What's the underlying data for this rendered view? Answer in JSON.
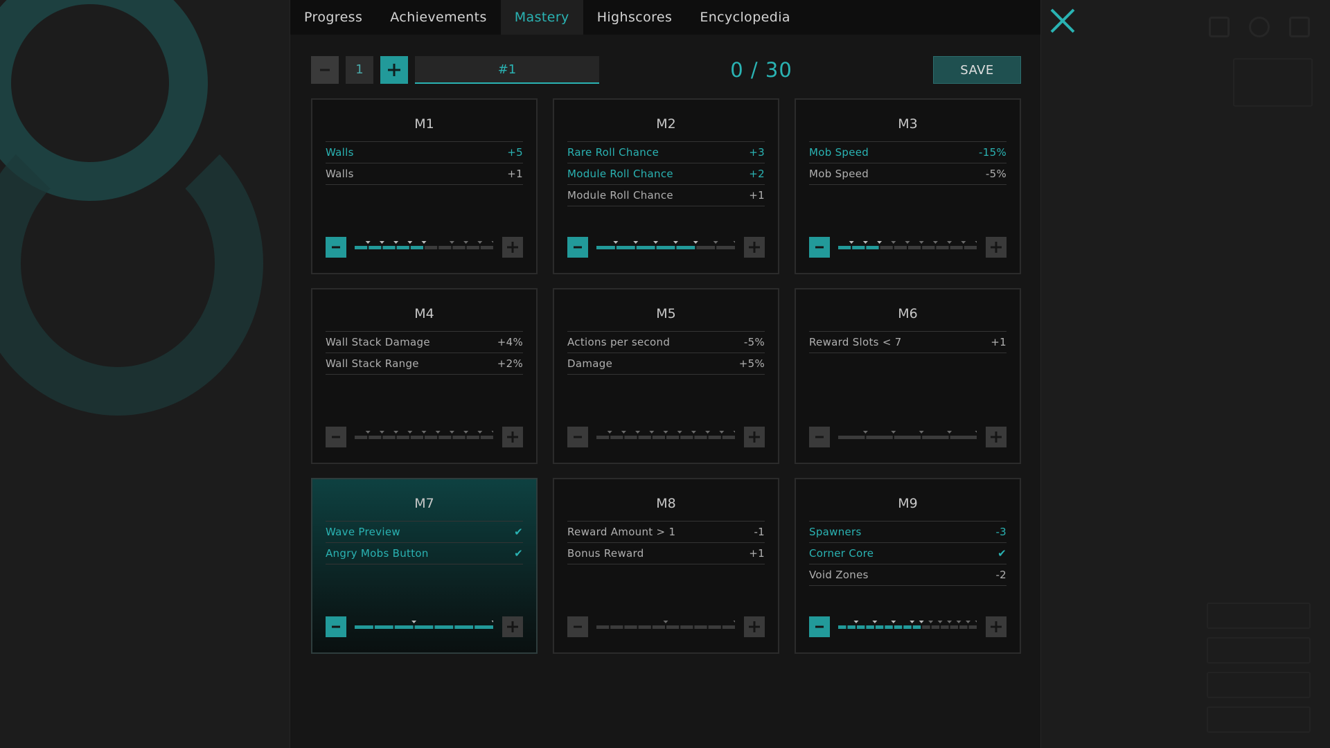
{
  "tabs": [
    "Progress",
    "Achievements",
    "Mastery",
    "Highscores",
    "Encyclopedia"
  ],
  "active_tab": 2,
  "toolbar": {
    "preset_number": "1",
    "preset_name": "#1",
    "points": "0 / 30",
    "save_label": "SAVE"
  },
  "colors": {
    "accent": "#2ab3b3",
    "accent_button": "#229a9a",
    "inactive": "#3a3a3a",
    "text": "#b0b0b0"
  },
  "icons": {
    "close": "close-icon",
    "minus": "minus-icon",
    "plus": "plus-icon",
    "check": "check-icon"
  },
  "cards": [
    {
      "title": "M1",
      "active": true,
      "highlight": false,
      "stats": [
        {
          "label": "Walls",
          "value": "+5",
          "on": true
        },
        {
          "label": "Walls",
          "value": "+1",
          "on": false
        }
      ],
      "level": {
        "segments": 10,
        "filled": 5,
        "markers": [
          1,
          2,
          3,
          4,
          5,
          7,
          8,
          9,
          10
        ]
      }
    },
    {
      "title": "M2",
      "active": true,
      "highlight": false,
      "stats": [
        {
          "label": "Rare Roll Chance",
          "value": "+3",
          "on": true
        },
        {
          "label": "Module Roll Chance",
          "value": "+2",
          "on": true
        },
        {
          "label": "Module Roll Chance",
          "value": "+1",
          "on": false
        }
      ],
      "level": {
        "segments": 7,
        "filled": 5,
        "markers": [
          1,
          2,
          3,
          4,
          5,
          6,
          7
        ]
      }
    },
    {
      "title": "M3",
      "active": true,
      "highlight": false,
      "stats": [
        {
          "label": "Mob Speed",
          "value": "-15%",
          "on": true
        },
        {
          "label": "Mob Speed",
          "value": "-5%",
          "on": false
        }
      ],
      "level": {
        "segments": 10,
        "filled": 3,
        "markers": [
          1,
          2,
          3,
          4,
          5,
          6,
          7,
          8,
          9,
          10
        ]
      }
    },
    {
      "title": "M4",
      "active": false,
      "highlight": false,
      "stats": [
        {
          "label": "Wall Stack Damage",
          "value": "+4%",
          "on": false
        },
        {
          "label": "Wall Stack Range",
          "value": "+2%",
          "on": false
        }
      ],
      "level": {
        "segments": 10,
        "filled": 0,
        "markers": [
          1,
          2,
          3,
          4,
          5,
          6,
          7,
          8,
          9,
          10
        ]
      }
    },
    {
      "title": "M5",
      "active": false,
      "highlight": false,
      "stats": [
        {
          "label": "Actions per second",
          "value": "-5%",
          "on": false
        },
        {
          "label": "Damage",
          "value": "+5%",
          "on": false
        }
      ],
      "level": {
        "segments": 10,
        "filled": 0,
        "markers": [
          1,
          2,
          3,
          4,
          5,
          6,
          7,
          8,
          9,
          10
        ]
      }
    },
    {
      "title": "M6",
      "active": false,
      "highlight": false,
      "stats": [
        {
          "label": "Reward Slots < 7",
          "value": "+1",
          "on": false
        }
      ],
      "level": {
        "segments": 5,
        "filled": 0,
        "markers": [
          1,
          2,
          3,
          4,
          5
        ]
      }
    },
    {
      "title": "M7",
      "active": true,
      "highlight": true,
      "stats": [
        {
          "label": "Wave Preview",
          "value": "✔",
          "on": true
        },
        {
          "label": "Angry Mobs Button",
          "value": "✔",
          "on": true
        }
      ],
      "level": {
        "segments": 7,
        "filled": 7,
        "markers": [
          3,
          7
        ]
      }
    },
    {
      "title": "M8",
      "active": false,
      "highlight": false,
      "stats": [
        {
          "label": "Reward Amount > 1",
          "value": "-1",
          "on": false
        },
        {
          "label": "Bonus Reward",
          "value": "+1",
          "on": false
        }
      ],
      "level": {
        "segments": 10,
        "filled": 0,
        "markers": [
          5,
          10
        ]
      }
    },
    {
      "title": "M9",
      "active": true,
      "highlight": false,
      "stats": [
        {
          "label": "Spawners",
          "value": "-3",
          "on": true
        },
        {
          "label": "Corner Core",
          "value": "✔",
          "on": true
        },
        {
          "label": "Void Zones",
          "value": "-2",
          "on": false
        }
      ],
      "level": {
        "segments": 15,
        "filled": 9,
        "markers": [
          2,
          4,
          6,
          8,
          9,
          10,
          11,
          12,
          13,
          14,
          15
        ]
      }
    }
  ]
}
